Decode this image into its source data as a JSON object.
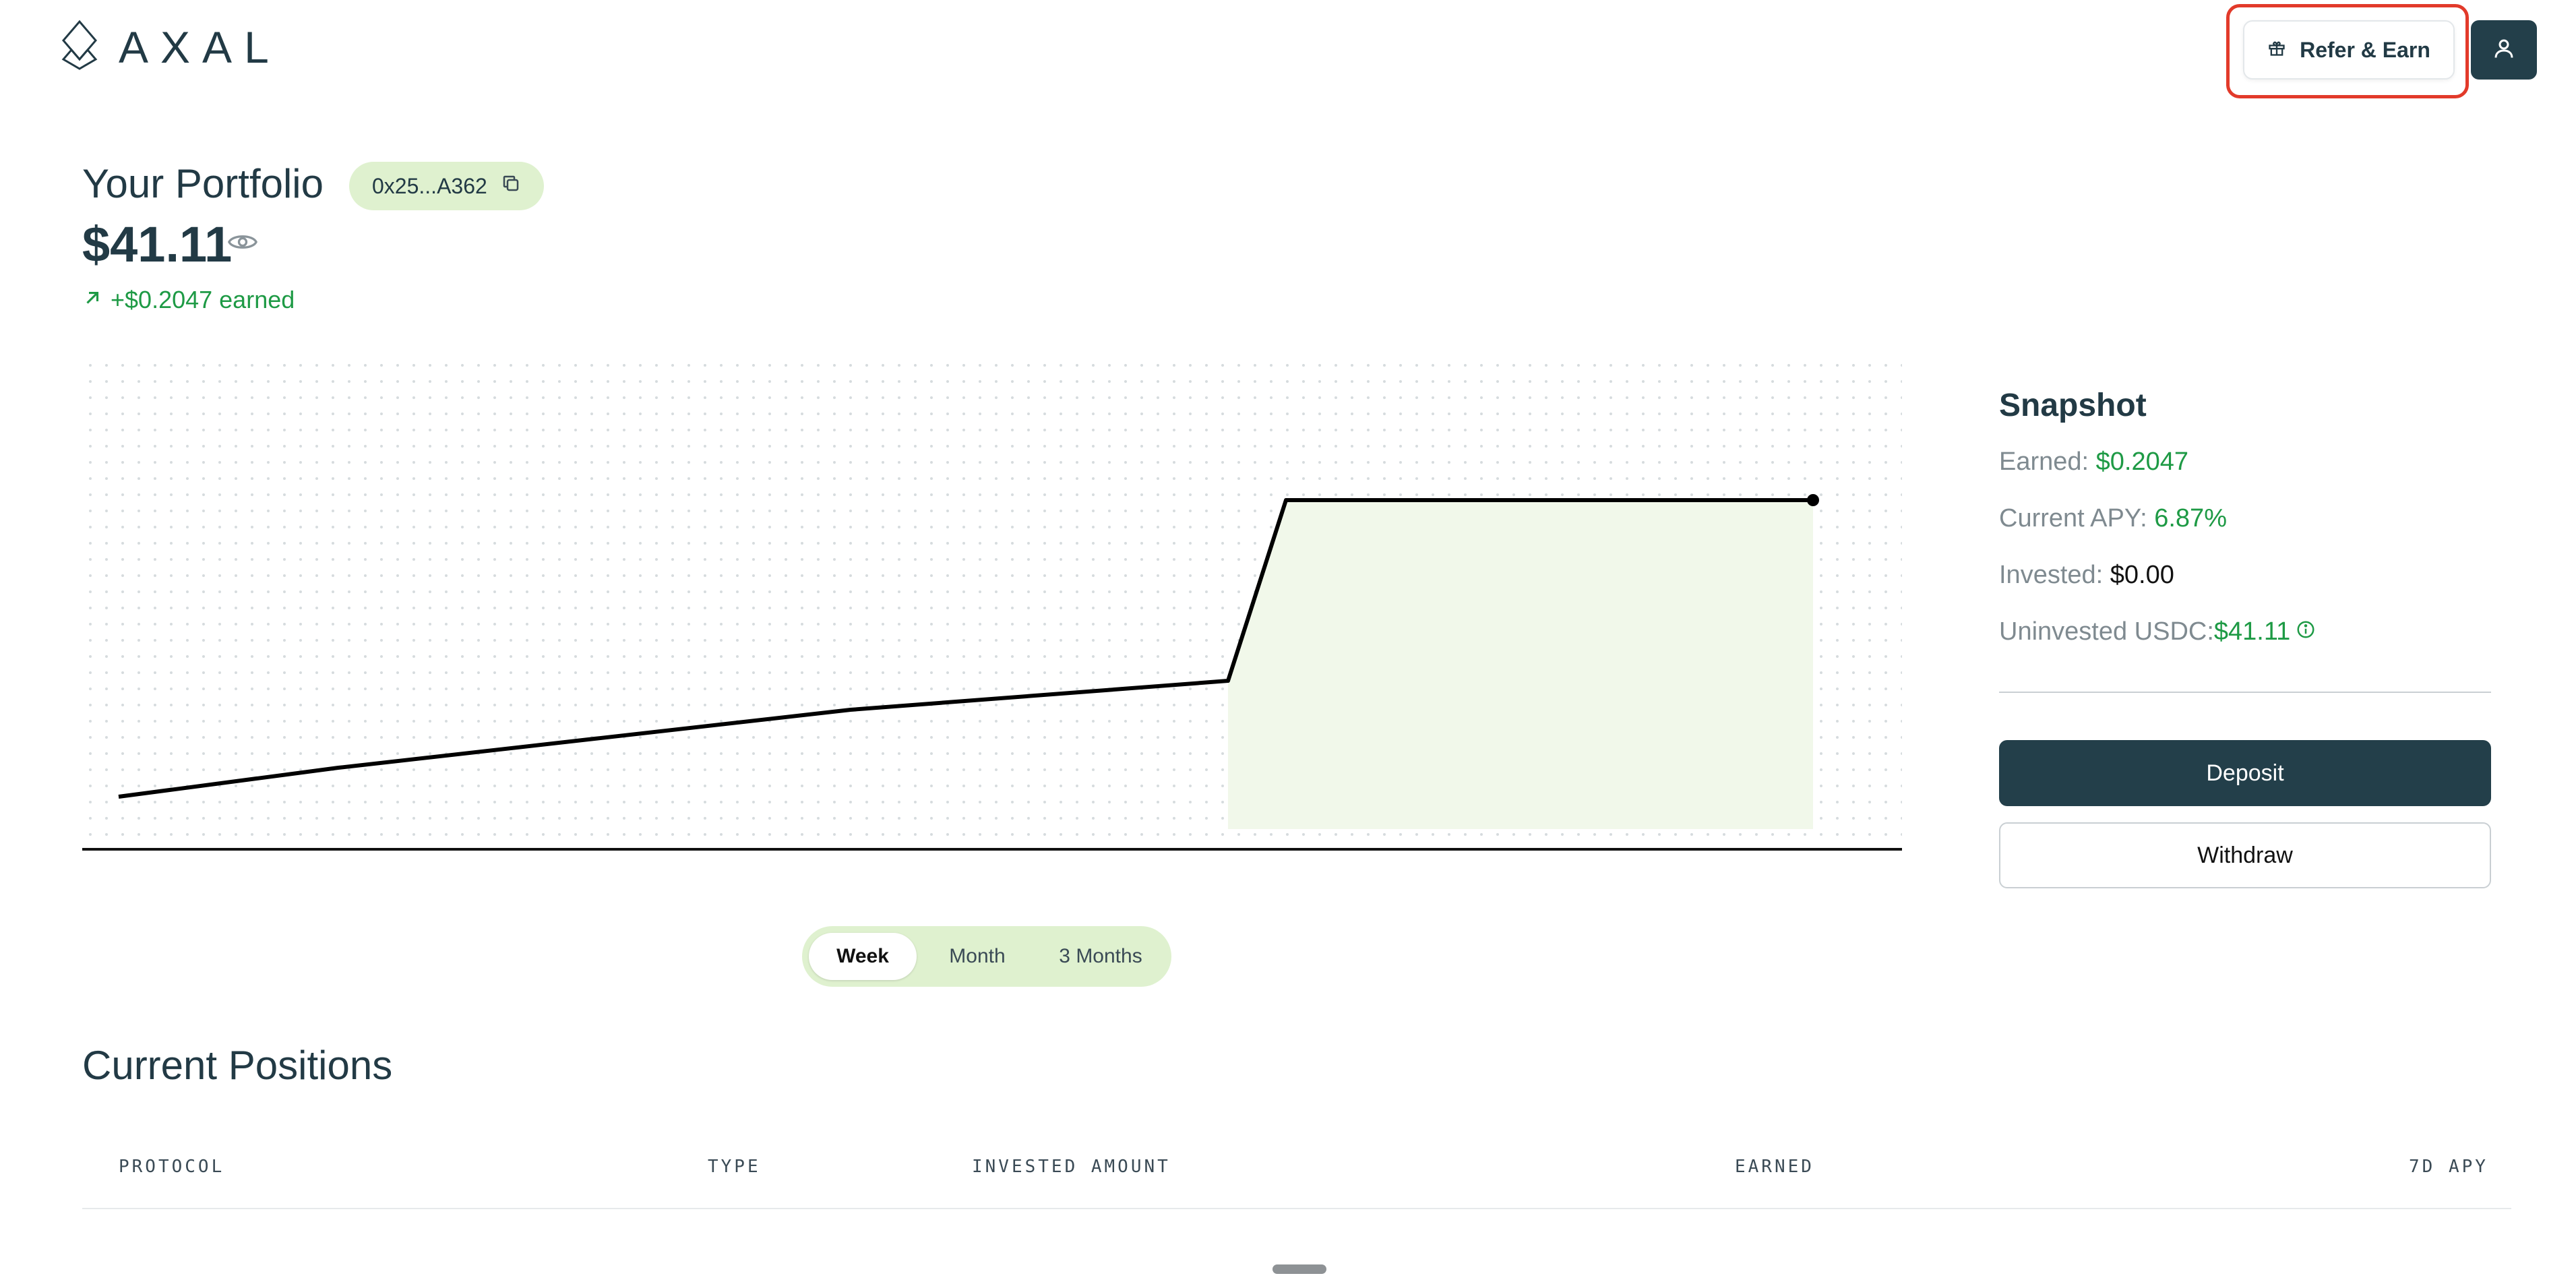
{
  "header": {
    "logo_text": "AXAL",
    "refer_label": "Refer & Earn"
  },
  "portfolio": {
    "title": "Your Portfolio",
    "address": "0x25...A362",
    "value": "$41.11",
    "earned_text": "+$0.2047 earned"
  },
  "chart_data": {
    "type": "line",
    "title": "",
    "xlabel": "",
    "ylabel": "",
    "series": [
      {
        "values": [
          0.0,
          0.02,
          0.04,
          0.06,
          0.08,
          0.2047,
          0.2047,
          0.2047,
          0.2047
        ]
      }
    ],
    "grid": "dotted",
    "fill": "#f1f8ea",
    "line_color": "#000000"
  },
  "range": {
    "tabs": [
      "Week",
      "Month",
      "3 Months"
    ],
    "active": "Week"
  },
  "snapshot": {
    "title": "Snapshot",
    "earned_label": "Earned: ",
    "earned_value": "$0.2047",
    "apy_label": "Current APY: ",
    "apy_value": "6.87%",
    "invested_label": "Invested: ",
    "invested_value": "$0.00",
    "uninvested_label": "Uninvested USDC: ",
    "uninvested_value": "$41.11",
    "deposit_label": "Deposit",
    "withdraw_label": "Withdraw"
  },
  "positions": {
    "title": "Current Positions",
    "columns": [
      "PROTOCOL",
      "TYPE",
      "INVESTED AMOUNT",
      "EARNED",
      "7D APY"
    ]
  },
  "colors": {
    "brand_dark": "#233f4a",
    "accent_green": "#1e9a45",
    "pill_green": "#dff1cf",
    "highlight_red": "#e23a2a"
  }
}
